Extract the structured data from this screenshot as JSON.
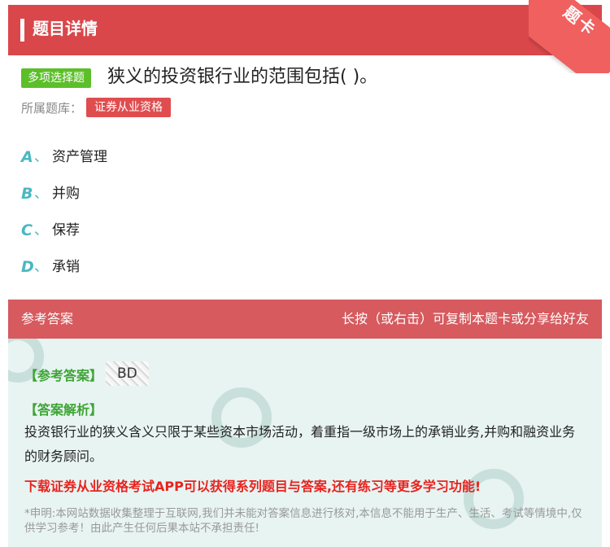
{
  "header": {
    "title": "题目详情",
    "corner_badge": "题卡"
  },
  "question": {
    "type_tag": "多项选择题",
    "text": "狭义的投资银行业的范围包括( )。",
    "library_label": "所属题库：",
    "library_tag": "证券从业资格",
    "options": [
      {
        "letter": "A",
        "sep": "、",
        "text": "资产管理"
      },
      {
        "letter": "B",
        "sep": "、",
        "text": "并购"
      },
      {
        "letter": "C",
        "sep": "、",
        "text": "保荐"
      },
      {
        "letter": "D",
        "sep": "、",
        "text": "承销"
      }
    ]
  },
  "answer": {
    "section_title": "参考答案",
    "share_hint": "长按（或右击）可复制本题卡或分享给好友",
    "ref_label": "【参考答案】",
    "ref_value": "BD",
    "explain_label": "【答案解析】",
    "explain_text": "投资银行业的狭义含义只限于某些资本市场活动，着重指一级市场上的承销业务,并购和融资业务的财务顾问。",
    "promo": "下载证券从业资格考试APP可以获得系列题目与答案,还有练习等更多学习功能!",
    "disclaimer": "*申明:本网站数据收集整理于互联网,我们并未能对答案信息进行核对,本信息不能用于生产、生活、考试等情境中,仅供学习参考！由此产生任何后果本站不承担责任!"
  },
  "colors": {
    "header": "#d9474b",
    "answer_head": "#d65a5e",
    "answer_bg": "#e8f4f2",
    "option_letter": "#4ab8c2",
    "green_label": "#3ea535",
    "promo": "#e8231f"
  }
}
